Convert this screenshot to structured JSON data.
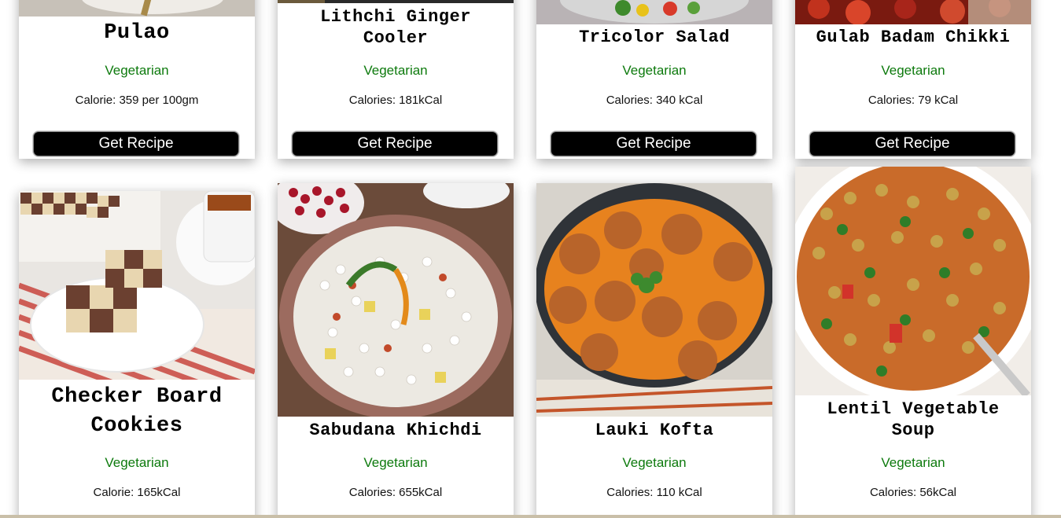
{
  "cards_top": [
    {
      "title": "Pulao",
      "diet": "Vegetarian",
      "calories": "Calorie: 359 per 100gm",
      "button": "Get Recipe",
      "image_icon": "pulao-dish-photo"
    },
    {
      "title": "Lithchi Ginger Cooler",
      "diet": "Vegetarian",
      "calories": "Calories: 181kCal",
      "button": "Get Recipe",
      "image_icon": "drink-photo"
    },
    {
      "title": "Tricolor Salad",
      "diet": "Vegetarian",
      "calories": "Calories: 340 kCal",
      "button": "Get Recipe",
      "image_icon": "salad-photo"
    },
    {
      "title": "Gulab Badam Chikki",
      "diet": "Vegetarian",
      "calories": "Calories: 79 kCal",
      "button": "Get Recipe",
      "image_icon": "chikki-photo"
    }
  ],
  "cards_bottom": [
    {
      "title": "Checker Board Cookies",
      "diet": "Vegetarian",
      "calories": "Calorie: 165kCal",
      "image_icon": "checkerboard-cookies-photo"
    },
    {
      "title": "Sabudana Khichdi",
      "diet": "Vegetarian",
      "calories": "Calories: 655kCal",
      "image_icon": "sabudana-khichdi-photo"
    },
    {
      "title": "Lauki Kofta",
      "diet": "Vegetarian",
      "calories": "Calories: 110 kCal",
      "image_icon": "lauki-kofta-photo"
    },
    {
      "title": "Lentil Vegetable Soup",
      "diet": "Vegetarian",
      "calories": "Calories: 56kCal",
      "image_icon": "lentil-soup-photo"
    }
  ],
  "colors": {
    "diet_green": "#0d7a0d",
    "button_bg": "#000000",
    "button_text": "#ffffff"
  }
}
